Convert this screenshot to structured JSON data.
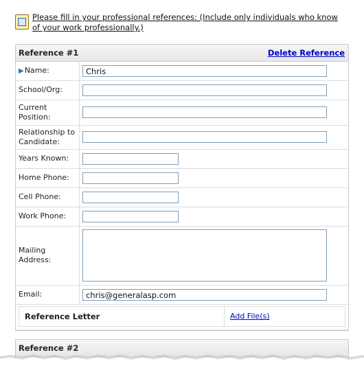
{
  "instructions": {
    "icon": "notepad-icon",
    "text": "Please fill in your professional references: (Include only individuals who know of your work professionally.)"
  },
  "reference1": {
    "title": "Reference #1",
    "delete_label": "Delete Reference",
    "fields": {
      "name": {
        "label": "Name:",
        "value": "Chris"
      },
      "school": {
        "label": "School/Org:",
        "value": ""
      },
      "position": {
        "label": "Current Position:",
        "value": ""
      },
      "relationship": {
        "label": "Relationship to Candidate:",
        "value": ""
      },
      "years": {
        "label": "Years Known:",
        "value": ""
      },
      "home_phone": {
        "label": "Home Phone:",
        "value": ""
      },
      "cell_phone": {
        "label": "Cell Phone:",
        "value": ""
      },
      "work_phone": {
        "label": "Work Phone:",
        "value": ""
      },
      "mailing": {
        "label": "Mailing Address:",
        "value": ""
      },
      "email": {
        "label": "Email:",
        "value": "chris@generalasp.com"
      }
    },
    "letter": {
      "label": "Reference Letter",
      "link": "Add File(s)"
    }
  },
  "reference2": {
    "title": "Reference #2"
  },
  "colors": {
    "link": "#0000cc",
    "arrow": "#2f6fd1",
    "input_border": "#7f9db9"
  }
}
